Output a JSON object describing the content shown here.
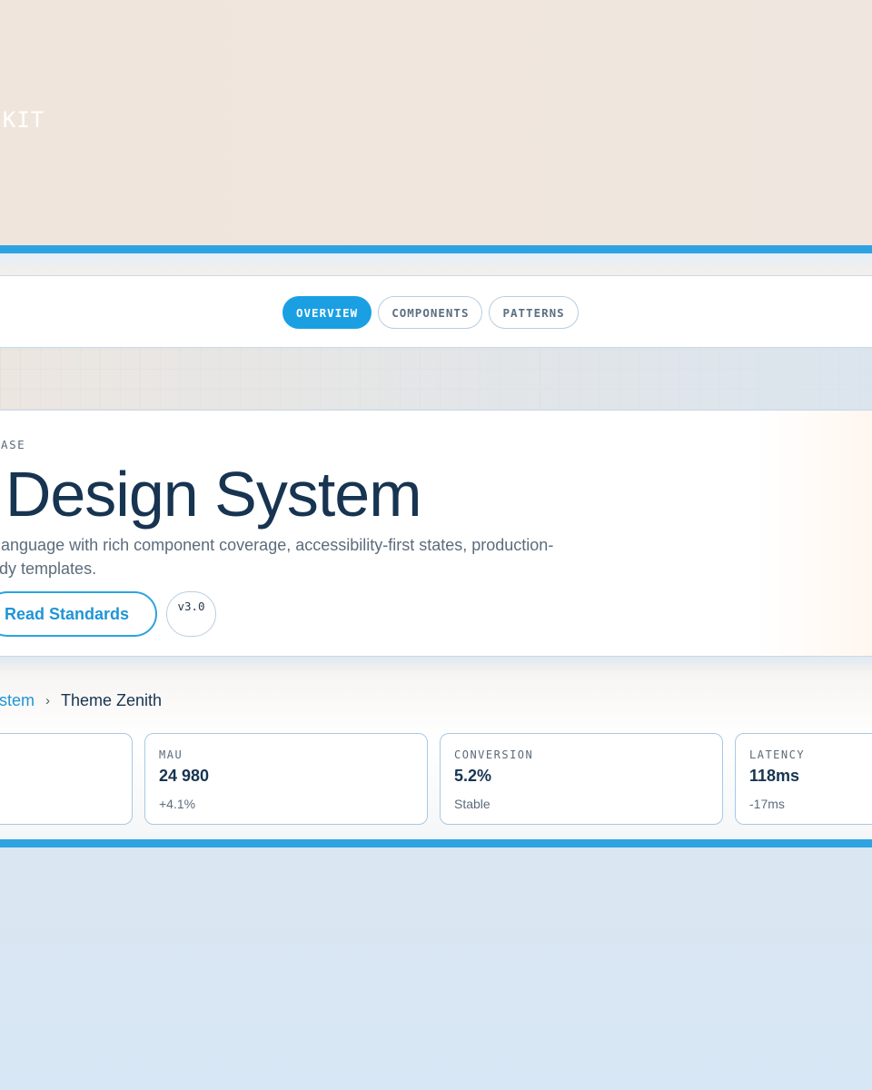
{
  "header": {
    "kit_label": "N-KIT"
  },
  "nav": {
    "tabs": [
      {
        "label": "OVERVIEW",
        "active": true
      },
      {
        "label": "COMPONENTS",
        "active": false
      },
      {
        "label": "PATTERNS",
        "active": false
      }
    ]
  },
  "hero": {
    "eyebrow": "LEASE",
    "title": "th Design System",
    "description": "ce language with rich component coverage, accessibility-first states, production-ready templates.",
    "cta_label": "Read Standards",
    "version": "v3.0"
  },
  "breadcrumb": {
    "parent": "ystem",
    "separator": "›",
    "current": "Theme Zenith"
  },
  "metrics": [
    {
      "label": "",
      "value": "",
      "note": ""
    },
    {
      "label": "MAU",
      "value": "24 980",
      "note": "+4.1%"
    },
    {
      "label": "CONVERSION",
      "value": "5.2%",
      "note": "Stable"
    },
    {
      "label": "LATENCY",
      "value": "118ms",
      "note": "-17ms"
    }
  ],
  "colors": {
    "accent": "#1aa0e2",
    "heading": "#173451",
    "frame_border": "#2ea3e2"
  }
}
